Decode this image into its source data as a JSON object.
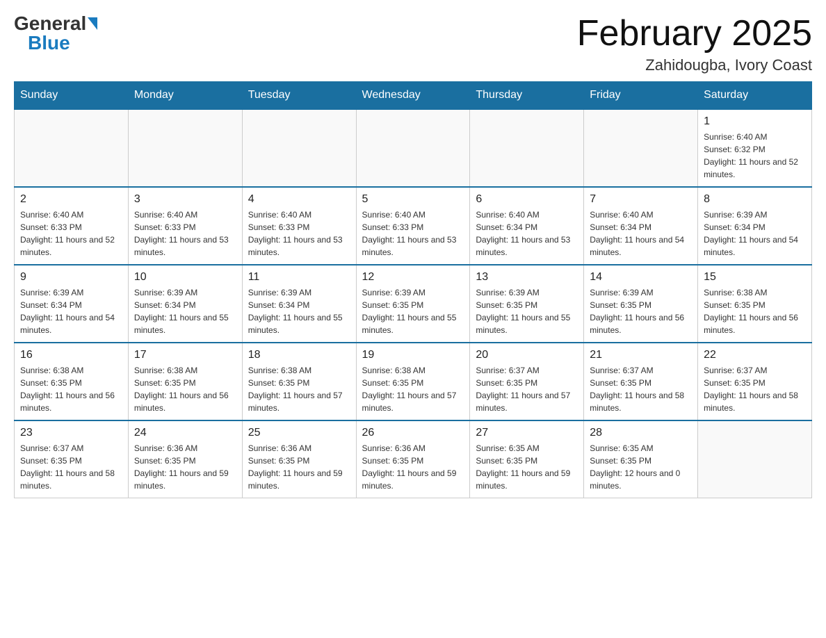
{
  "header": {
    "logo_general": "General",
    "logo_blue": "Blue",
    "month_title": "February 2025",
    "location": "Zahidougba, Ivory Coast"
  },
  "days_of_week": [
    "Sunday",
    "Monday",
    "Tuesday",
    "Wednesday",
    "Thursday",
    "Friday",
    "Saturday"
  ],
  "weeks": [
    [
      {
        "day": "",
        "info": ""
      },
      {
        "day": "",
        "info": ""
      },
      {
        "day": "",
        "info": ""
      },
      {
        "day": "",
        "info": ""
      },
      {
        "day": "",
        "info": ""
      },
      {
        "day": "",
        "info": ""
      },
      {
        "day": "1",
        "info": "Sunrise: 6:40 AM\nSunset: 6:32 PM\nDaylight: 11 hours and 52 minutes."
      }
    ],
    [
      {
        "day": "2",
        "info": "Sunrise: 6:40 AM\nSunset: 6:33 PM\nDaylight: 11 hours and 52 minutes."
      },
      {
        "day": "3",
        "info": "Sunrise: 6:40 AM\nSunset: 6:33 PM\nDaylight: 11 hours and 53 minutes."
      },
      {
        "day": "4",
        "info": "Sunrise: 6:40 AM\nSunset: 6:33 PM\nDaylight: 11 hours and 53 minutes."
      },
      {
        "day": "5",
        "info": "Sunrise: 6:40 AM\nSunset: 6:33 PM\nDaylight: 11 hours and 53 minutes."
      },
      {
        "day": "6",
        "info": "Sunrise: 6:40 AM\nSunset: 6:34 PM\nDaylight: 11 hours and 53 minutes."
      },
      {
        "day": "7",
        "info": "Sunrise: 6:40 AM\nSunset: 6:34 PM\nDaylight: 11 hours and 54 minutes."
      },
      {
        "day": "8",
        "info": "Sunrise: 6:39 AM\nSunset: 6:34 PM\nDaylight: 11 hours and 54 minutes."
      }
    ],
    [
      {
        "day": "9",
        "info": "Sunrise: 6:39 AM\nSunset: 6:34 PM\nDaylight: 11 hours and 54 minutes."
      },
      {
        "day": "10",
        "info": "Sunrise: 6:39 AM\nSunset: 6:34 PM\nDaylight: 11 hours and 55 minutes."
      },
      {
        "day": "11",
        "info": "Sunrise: 6:39 AM\nSunset: 6:34 PM\nDaylight: 11 hours and 55 minutes."
      },
      {
        "day": "12",
        "info": "Sunrise: 6:39 AM\nSunset: 6:35 PM\nDaylight: 11 hours and 55 minutes."
      },
      {
        "day": "13",
        "info": "Sunrise: 6:39 AM\nSunset: 6:35 PM\nDaylight: 11 hours and 55 minutes."
      },
      {
        "day": "14",
        "info": "Sunrise: 6:39 AM\nSunset: 6:35 PM\nDaylight: 11 hours and 56 minutes."
      },
      {
        "day": "15",
        "info": "Sunrise: 6:38 AM\nSunset: 6:35 PM\nDaylight: 11 hours and 56 minutes."
      }
    ],
    [
      {
        "day": "16",
        "info": "Sunrise: 6:38 AM\nSunset: 6:35 PM\nDaylight: 11 hours and 56 minutes."
      },
      {
        "day": "17",
        "info": "Sunrise: 6:38 AM\nSunset: 6:35 PM\nDaylight: 11 hours and 56 minutes."
      },
      {
        "day": "18",
        "info": "Sunrise: 6:38 AM\nSunset: 6:35 PM\nDaylight: 11 hours and 57 minutes."
      },
      {
        "day": "19",
        "info": "Sunrise: 6:38 AM\nSunset: 6:35 PM\nDaylight: 11 hours and 57 minutes."
      },
      {
        "day": "20",
        "info": "Sunrise: 6:37 AM\nSunset: 6:35 PM\nDaylight: 11 hours and 57 minutes."
      },
      {
        "day": "21",
        "info": "Sunrise: 6:37 AM\nSunset: 6:35 PM\nDaylight: 11 hours and 58 minutes."
      },
      {
        "day": "22",
        "info": "Sunrise: 6:37 AM\nSunset: 6:35 PM\nDaylight: 11 hours and 58 minutes."
      }
    ],
    [
      {
        "day": "23",
        "info": "Sunrise: 6:37 AM\nSunset: 6:35 PM\nDaylight: 11 hours and 58 minutes."
      },
      {
        "day": "24",
        "info": "Sunrise: 6:36 AM\nSunset: 6:35 PM\nDaylight: 11 hours and 59 minutes."
      },
      {
        "day": "25",
        "info": "Sunrise: 6:36 AM\nSunset: 6:35 PM\nDaylight: 11 hours and 59 minutes."
      },
      {
        "day": "26",
        "info": "Sunrise: 6:36 AM\nSunset: 6:35 PM\nDaylight: 11 hours and 59 minutes."
      },
      {
        "day": "27",
        "info": "Sunrise: 6:35 AM\nSunset: 6:35 PM\nDaylight: 11 hours and 59 minutes."
      },
      {
        "day": "28",
        "info": "Sunrise: 6:35 AM\nSunset: 6:35 PM\nDaylight: 12 hours and 0 minutes."
      },
      {
        "day": "",
        "info": ""
      }
    ]
  ]
}
